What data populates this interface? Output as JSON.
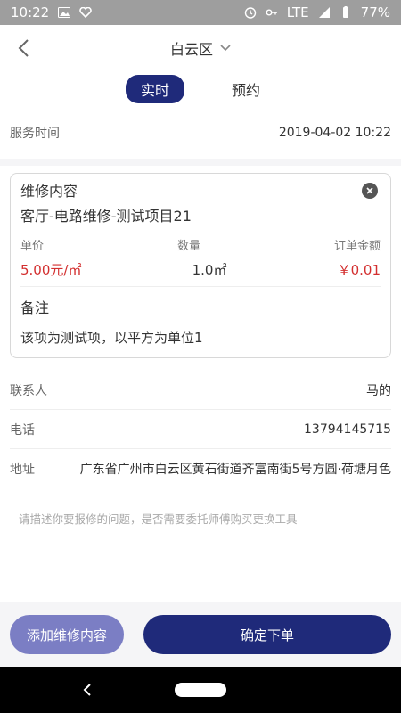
{
  "status_bar": {
    "time": "10:22",
    "network": "LTE",
    "battery": "77%"
  },
  "nav": {
    "title": "白云区"
  },
  "tabs": [
    {
      "label": "实时",
      "active": true
    },
    {
      "label": "预约",
      "active": false
    }
  ],
  "service": {
    "label": "服务时间",
    "value": "2019-04-02 10:22"
  },
  "repair_card": {
    "title": "维修内容",
    "item": "客厅-电路维修-测试项目21",
    "headers": {
      "unit_price": "单价",
      "quantity": "数量",
      "amount": "订单金额"
    },
    "values": {
      "unit_price": "5.00元/㎡",
      "quantity": "1.0㎡",
      "amount": "￥0.01"
    },
    "remark_title": "备注",
    "remark_text": "该项为测试项，以平方为单位1"
  },
  "contact": {
    "label": "联系人",
    "value": "马的"
  },
  "phone": {
    "label": "电话",
    "value": "13794145715"
  },
  "address": {
    "label": "地址",
    "value": "广东省广州市白云区黄石街道齐富南街5号方圆·荷塘月色"
  },
  "description": {
    "placeholder": "请描述你要报修的问题，是否需要委托师傅购买更换工具"
  },
  "buttons": {
    "add": "添加维修内容",
    "confirm": "确定下单"
  },
  "colors": {
    "primary": "#1f2a7a",
    "secondary": "#7b7ec4",
    "price_red": "#d32f2f"
  }
}
